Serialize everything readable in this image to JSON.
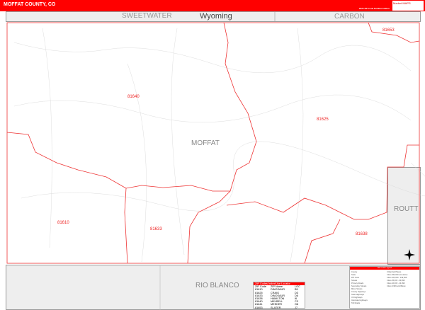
{
  "header": {
    "title": "MOFFAT COUNTY, CO",
    "edition": "2025 ZIP Code Redline Edition",
    "logo": "Market MAPS"
  },
  "neighbors": {
    "top_left": "SWEETWATER",
    "state": "Wyoming",
    "top_right": "CARBON",
    "right": "ROUTT",
    "bottom": "RIO BLANCO"
  },
  "county_label": "MOFFAT",
  "zip_labels": [
    "81640",
    "81625",
    "81610",
    "81633",
    "81638",
    "81653"
  ],
  "zip_table": {
    "title": "ZIP Codes Index/Use Locator",
    "headers": [
      "ZIP Code",
      "ZIP Name",
      "LOC"
    ],
    "rows": [
      [
        "81610",
        "DINOSAUR",
        "B5"
      ],
      [
        "81625",
        "CRAIG",
        "D3"
      ],
      [
        "81633",
        "DINOSAUR",
        "D6"
      ],
      [
        "81638",
        "HAMILTON",
        "I6"
      ],
      [
        "81640",
        "MAYBELL",
        "C3"
      ],
      [
        "81641",
        "MEEKER",
        "G8"
      ],
      [
        "81653",
        "SLATER",
        "J7"
      ]
    ]
  },
  "legend": {
    "title": "ZIP Code Legend",
    "left": [
      "County",
      "State",
      "ZIP Code",
      "Streets",
      "Primary Roads",
      "Secondary Streets",
      "Minor Streets",
      "County Highways",
      "State Highways",
      "US Highways",
      "Interstate Highways",
      "Toll Roads"
    ],
    "right": [
      "Urbanized Places",
      "Cities 250,000 and above",
      "Cities 100,000 - 249,999",
      "Cities 25,000 - 99,999",
      "Cities 10,000 - 24,999",
      "Cities 9,999 and Below"
    ]
  },
  "colors": {
    "accent": "#ff0000",
    "boundary": "#e33333"
  }
}
